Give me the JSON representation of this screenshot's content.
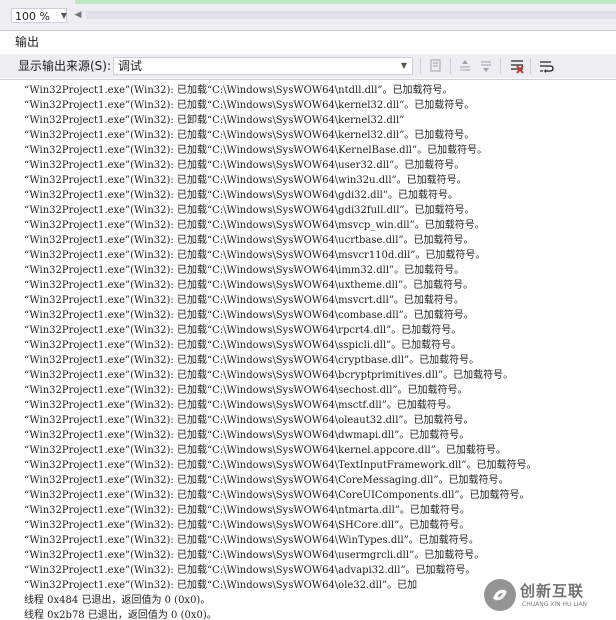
{
  "editor": {
    "zoom": "100 %"
  },
  "output_panel": {
    "title": "输出",
    "source_label": "显示输出来源(S):",
    "source_value": "调试"
  },
  "lines": [
    "“Win32Project1.exe”(Win32): 已加载“C:\\Windows\\SysWOW64\\ntdll.dll”。已加载符号。",
    "“Win32Project1.exe”(Win32): 已加载“C:\\Windows\\SysWOW64\\kernel32.dll”。已加载符号。",
    "“Win32Project1.exe”(Win32): 已卸载“C:\\Windows\\SysWOW64\\kernel32.dll”",
    "“Win32Project1.exe”(Win32): 已加载“C:\\Windows\\SysWOW64\\kernel32.dll”。已加载符号。",
    "“Win32Project1.exe”(Win32): 已加载“C:\\Windows\\SysWOW64\\KernelBase.dll”。已加载符号。",
    "“Win32Project1.exe”(Win32): 已加载“C:\\Windows\\SysWOW64\\user32.dll”。已加载符号。",
    "“Win32Project1.exe”(Win32): 已加载“C:\\Windows\\SysWOW64\\win32u.dll”。已加载符号。",
    "“Win32Project1.exe”(Win32): 已加载“C:\\Windows\\SysWOW64\\gdi32.dll”。已加载符号。",
    "“Win32Project1.exe”(Win32): 已加载“C:\\Windows\\SysWOW64\\gdi32full.dll”。已加载符号。",
    "“Win32Project1.exe”(Win32): 已加载“C:\\Windows\\SysWOW64\\msvcp_win.dll”。已加载符号。",
    "“Win32Project1.exe”(Win32): 已加载“C:\\Windows\\SysWOW64\\ucrtbase.dll”。已加载符号。",
    "“Win32Project1.exe”(Win32): 已加载“C:\\Windows\\SysWOW64\\msvcr110d.dll”。已加载符号。",
    "“Win32Project1.exe”(Win32): 已加载“C:\\Windows\\SysWOW64\\imm32.dll”。已加载符号。",
    "“Win32Project1.exe”(Win32): 已加载“C:\\Windows\\SysWOW64\\uxtheme.dll”。已加载符号。",
    "“Win32Project1.exe”(Win32): 已加载“C:\\Windows\\SysWOW64\\msvcrt.dll”。已加载符号。",
    "“Win32Project1.exe”(Win32): 已加载“C:\\Windows\\SysWOW64\\combase.dll”。已加载符号。",
    "“Win32Project1.exe”(Win32): 已加载“C:\\Windows\\SysWOW64\\rpcrt4.dll”。已加载符号。",
    "“Win32Project1.exe”(Win32): 已加载“C:\\Windows\\SysWOW64\\sspicli.dll”。已加载符号。",
    "“Win32Project1.exe”(Win32): 已加载“C:\\Windows\\SysWOW64\\cryptbase.dll”。已加载符号。",
    "“Win32Project1.exe”(Win32): 已加载“C:\\Windows\\SysWOW64\\bcryptprimitives.dll”。已加载符号。",
    "“Win32Project1.exe”(Win32): 已加载“C:\\Windows\\SysWOW64\\sechost.dll”。已加载符号。",
    "“Win32Project1.exe”(Win32): 已加载“C:\\Windows\\SysWOW64\\msctf.dll”。已加载符号。",
    "“Win32Project1.exe”(Win32): 已加载“C:\\Windows\\SysWOW64\\oleaut32.dll”。已加载符号。",
    "“Win32Project1.exe”(Win32): 已加载“C:\\Windows\\SysWOW64\\dwmapi.dll”。已加载符号。",
    "“Win32Project1.exe”(Win32): 已加载“C:\\Windows\\SysWOW64\\kernel.appcore.dll”。已加载符号。",
    "“Win32Project1.exe”(Win32): 已加载“C:\\Windows\\SysWOW64\\TextInputFramework.dll”。已加载符号。",
    "“Win32Project1.exe”(Win32): 已加载“C:\\Windows\\SysWOW64\\CoreMessaging.dll”。已加载符号。",
    "“Win32Project1.exe”(Win32): 已加载“C:\\Windows\\SysWOW64\\CoreUIComponents.dll”。已加载符号。",
    "“Win32Project1.exe”(Win32): 已加载“C:\\Windows\\SysWOW64\\ntmarta.dll”。已加载符号。",
    "“Win32Project1.exe”(Win32): 已加载“C:\\Windows\\SysWOW64\\SHCore.dll”。已加载符号。",
    "“Win32Project1.exe”(Win32): 已加载“C:\\Windows\\SysWOW64\\WinTypes.dll”。已加载符号。",
    "“Win32Project1.exe”(Win32): 已加载“C:\\Windows\\SysWOW64\\usermgrcli.dll”。已加载符号。",
    "“Win32Project1.exe”(Win32): 已加载“C:\\Windows\\SysWOW64\\advapi32.dll”。已加载符号。",
    "“Win32Project1.exe”(Win32): 已加载“C:\\Windows\\SysWOW64\\ole32.dll”。已加"
  ],
  "thread_lines": [
    "线程 0x484 已退出，返回值为 0 (0x0)。",
    "线程 0x2b78 已退出，返回值为 0 (0x0)。"
  ],
  "watermark": {
    "text": "创新互联",
    "subtext": "CHUANG XIN HU LIAN"
  }
}
